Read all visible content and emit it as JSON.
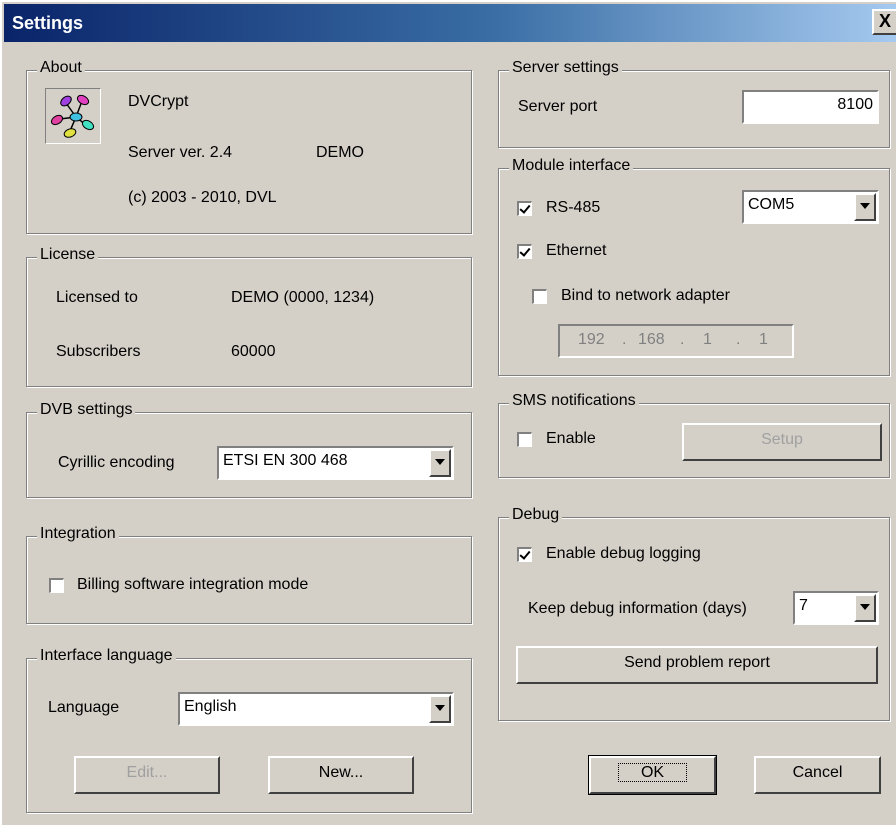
{
  "window": {
    "title": "Settings",
    "close_glyph": "X"
  },
  "about": {
    "title": "About",
    "icon": "dvcrypt-app-icon",
    "product": "DVCrypt",
    "version": "Server ver. 2.4",
    "edition": "DEMO",
    "copyright": "(c) 2003 - 2010, DVL"
  },
  "license": {
    "title": "License",
    "licensed_to_label": "Licensed to",
    "licensed_to_value": "DEMO (0000, 1234)",
    "subscribers_label": "Subscribers",
    "subscribers_value": "60000"
  },
  "dvb": {
    "title": "DVB settings",
    "cyrillic_label": "Cyrillic encoding",
    "cyrillic_value": "ETSI EN 300 468"
  },
  "integration": {
    "title": "Integration",
    "billing_label": "Billing software integration mode",
    "billing_checked": false
  },
  "language": {
    "title": "Interface language",
    "language_label": "Language",
    "language_value": "English",
    "edit_label": "Edit...",
    "new_label": "New..."
  },
  "server": {
    "title": "Server settings",
    "port_label": "Server port",
    "port_value": "8100"
  },
  "module": {
    "title": "Module interface",
    "rs485_label": "RS-485",
    "rs485_checked": true,
    "com_value": "COM5",
    "ethernet_label": "Ethernet",
    "ethernet_checked": true,
    "bind_label": "Bind to network adapter",
    "bind_checked": false,
    "ip_1": "192",
    "ip_2": "168",
    "ip_3": "1",
    "ip_4": "1",
    "ip_dot": "."
  },
  "sms": {
    "title": "SMS notifications",
    "enable_label": "Enable",
    "enable_checked": false,
    "setup_label": "Setup"
  },
  "debug": {
    "title": "Debug",
    "logging_label": "Enable debug logging",
    "logging_checked": true,
    "keep_label": "Keep debug information (days)",
    "keep_value": "7",
    "report_label": "Send problem report"
  },
  "actions": {
    "ok_label": "OK",
    "cancel_label": "Cancel"
  }
}
